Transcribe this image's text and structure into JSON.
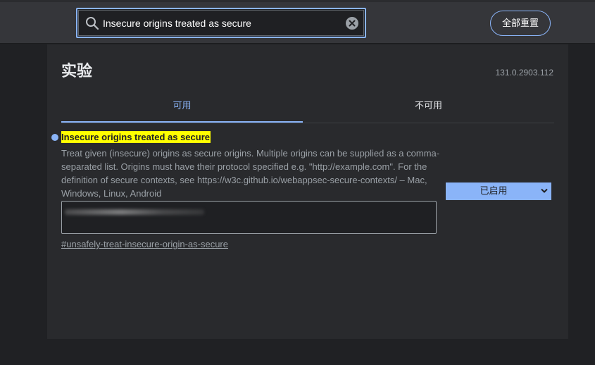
{
  "search": {
    "value": "Insecure origins treated as secure",
    "icon": "search-icon",
    "clear_icon": "close-icon"
  },
  "header": {
    "reset_label": "全部重置"
  },
  "page": {
    "title": "实验",
    "version": "131.0.2903.112"
  },
  "tabs": [
    {
      "label": "可用",
      "active": true
    },
    {
      "label": "不可用",
      "active": false
    }
  ],
  "experiment": {
    "title": "Insecure origins treated as secure",
    "description": "Treat given (insecure) origins as secure origins. Multiple origins can be supplied as a comma-separated list. Origins must have their protocol specified e.g. \"http://example.com\". For the definition of secure contexts, see https://w3c.github.io/webappsec-secure-contexts/ – Mac, Windows, Linux, Android",
    "link": "#unsafely-treat-insecure-origin-as-secure",
    "status_selected": "已启用"
  },
  "colors": {
    "accent": "#8ab4f8",
    "highlight": "#ffff00",
    "panel": "#292a2d",
    "background": "#202124"
  }
}
